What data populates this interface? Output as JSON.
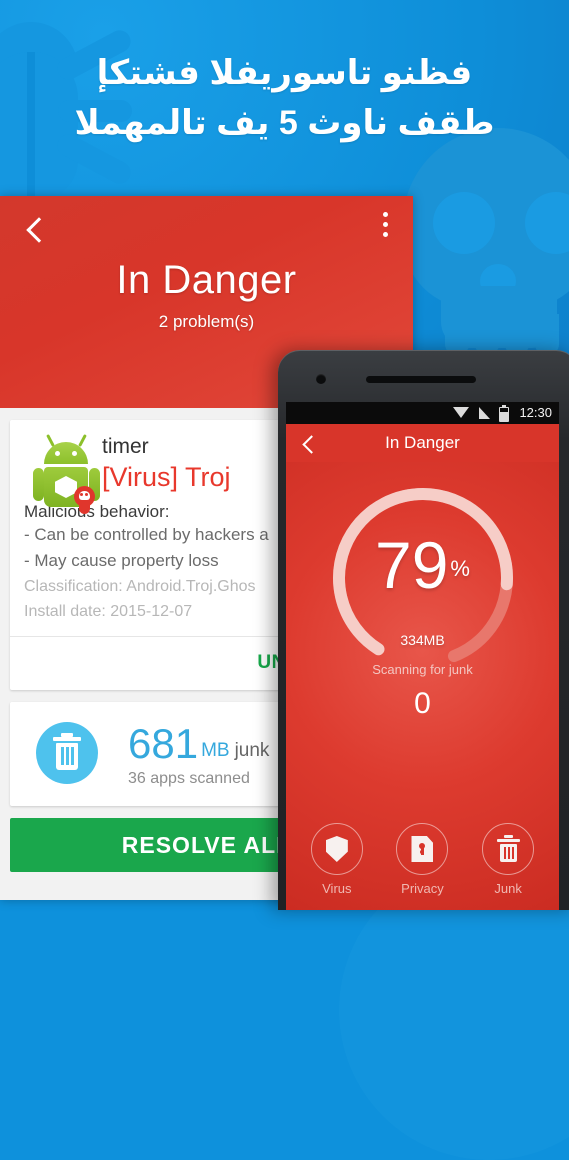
{
  "promo": {
    "headline_line1": "فظنو تاسوريفلا فشتكإ",
    "headline_line2": "طقف ناوث 5 يف تالمهملا",
    "background_color": "#0e91dc",
    "watermark_bug": "bug-watermark",
    "watermark_skull": "skull-watermark"
  },
  "panel": {
    "header": {
      "back_icon": "chevron-left-icon",
      "overflow_icon": "more-vertical-icon",
      "title": "In Danger",
      "subtitle": "2 problem(s)",
      "background_color": "#d8352a"
    },
    "virus_card": {
      "app_icon": "android-robot-virus-icon",
      "app_name": "timer",
      "threat_label": "[Virus] Troj",
      "behavior_heading": "Malicious behavior:",
      "behaviors": [
        "-  Can be controlled by hackers a",
        "-  May cause property loss"
      ],
      "classification": "Classification: Android.Troj.Ghos",
      "install_date": "Install date: 2015-12-07",
      "uninstall_label": "UNINSTALL",
      "uninstall_color": "#16a94a"
    },
    "junk_card": {
      "trash_icon": "trash-can-icon",
      "amount": "681",
      "unit": "MB",
      "word": "junk",
      "subtitle": "36 apps scanned",
      "accent_color": "#35a8dd"
    },
    "resolve_button": {
      "label": "RESOLVE ALL",
      "color": "#1aa74c"
    }
  },
  "phone": {
    "status_bar": {
      "wifi_icon": "wifi-icon",
      "signal_icon": "signal-icon",
      "battery_icon": "battery-icon",
      "time": "12:30"
    },
    "app_bar": {
      "back_icon": "chevron-left-icon",
      "title": "In Danger"
    },
    "gauge": {
      "percent": "79",
      "percent_symbol": "%",
      "size_value": "334",
      "size_unit": "MB",
      "status_text": "Scanning for junk",
      "count": "0",
      "track_color": "#e8776c",
      "progress_color": "#f6cdc7"
    },
    "actions": [
      {
        "icon": "shield-icon",
        "label": "Virus"
      },
      {
        "icon": "privacy-lock-document-icon",
        "label": "Privacy"
      },
      {
        "icon": "trash-can-icon",
        "label": "Junk"
      }
    ]
  }
}
